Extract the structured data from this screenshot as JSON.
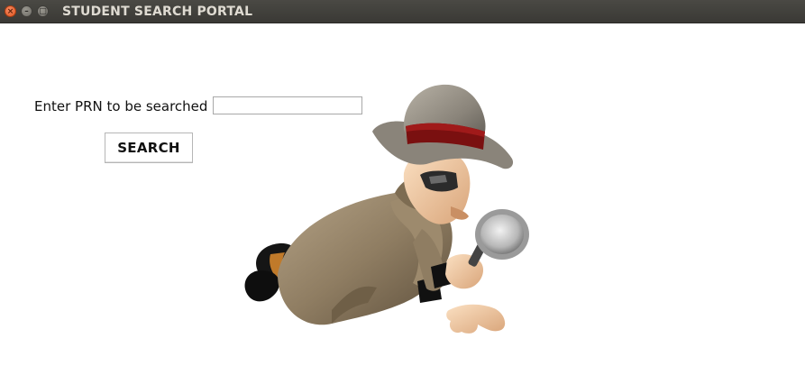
{
  "window": {
    "title": "STUDENT SEARCH PORTAL",
    "controls": {
      "close_glyph": "×",
      "minimize_glyph": "–",
      "maximize_glyph": "□"
    }
  },
  "form": {
    "prn_label": "Enter PRN to be searched",
    "prn_value": "",
    "prn_placeholder": "",
    "search_button_label": "SEARCH"
  },
  "illustration": {
    "name": "detective-with-magnifying-glass",
    "colors": {
      "hat": "#8a847a",
      "hat_band": "#7a1010",
      "coat": "#8f7d62",
      "skin": "#f1c9a0",
      "shoe": "#1a1a1a"
    }
  }
}
